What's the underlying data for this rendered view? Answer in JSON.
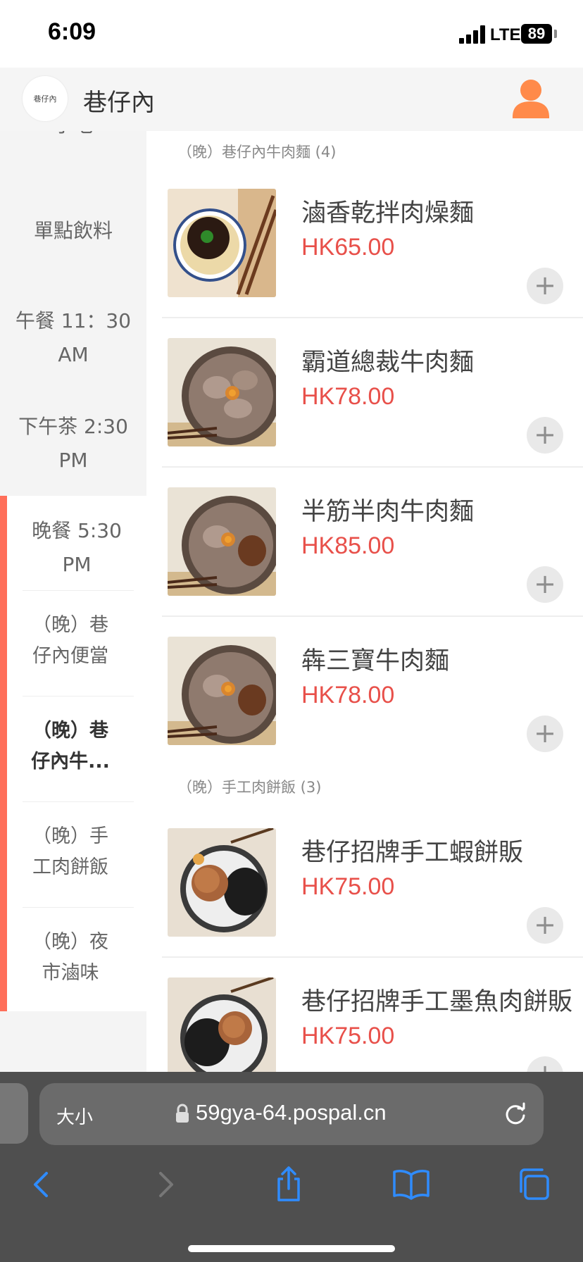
{
  "status": {
    "time": "6:09",
    "network": "LTE",
    "battery": "89"
  },
  "header": {
    "shop_name": "巷仔內",
    "logo_text": "巷仔內"
  },
  "sidebar": {
    "items": [
      {
        "label": "小吃"
      },
      {
        "label": "單點飲料"
      },
      {
        "label": "午餐 11：30 AM"
      },
      {
        "label": "下午茶 2:30 PM"
      },
      {
        "label": "晚餐 5:30 PM"
      }
    ],
    "sub_items": [
      {
        "label": "（晚）巷仔內便當"
      },
      {
        "label": "（晚）巷仔內牛..."
      },
      {
        "label": "（晚）手工肉餅飯"
      },
      {
        "label": "（晚）夜市滷味"
      }
    ]
  },
  "categories": [
    {
      "title": "（晚）巷仔內牛肉麵 (4)"
    },
    {
      "title": "（晚）手工肉餅飯 (3)"
    }
  ],
  "products": [
    {
      "name": "滷香乾拌肉燥麵",
      "price": "HK65.00",
      "image": "braised-pork-noodle"
    },
    {
      "name": "霸道總裁牛肉麵",
      "price": "HK78.00",
      "image": "beef-noodle"
    },
    {
      "name": "半筋半肉牛肉麵",
      "price": "HK85.00",
      "image": "beef-tendon-noodle"
    },
    {
      "name": "犇三寶牛肉麵",
      "price": "HK78.00",
      "image": "beef-three-treasures-noodle"
    },
    {
      "name": "巷仔招牌手工蝦餅販",
      "price": "HK75.00",
      "image": "shrimp-patty-rice"
    },
    {
      "name": "巷仔招牌手工墨魚肉餅販",
      "price": "HK75.00",
      "image": "cuttlefish-patty-rice"
    }
  ],
  "add_label": "+",
  "browser": {
    "text_size": "大小",
    "url": "59gya-64.pospal.cn"
  },
  "colors": {
    "accent": "#ff6f5a",
    "price": "#e8504a",
    "sidebar_bg": "#f4f4f4",
    "browser_bg": "#4f4f4f"
  }
}
